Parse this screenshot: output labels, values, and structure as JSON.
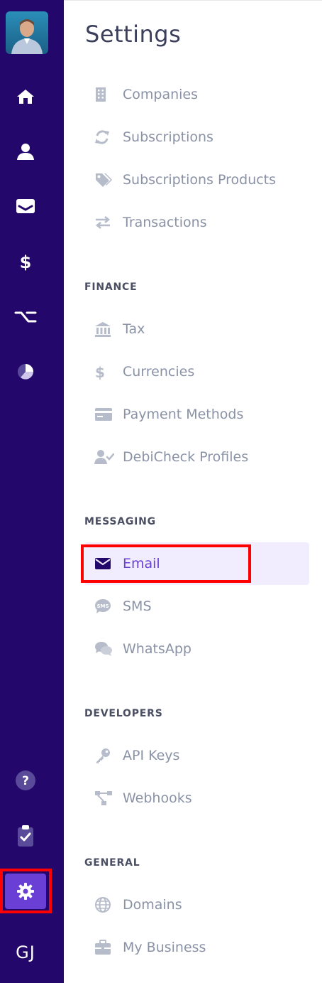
{
  "rail": {
    "items": [
      {
        "name": "home-icon"
      },
      {
        "name": "contacts-icon"
      },
      {
        "name": "inbox-icon"
      },
      {
        "name": "dollar-icon"
      },
      {
        "name": "workflow-icon"
      },
      {
        "name": "reports-pie-icon"
      },
      {
        "name": "help-icon"
      },
      {
        "name": "tasks-clipboard-icon"
      },
      {
        "name": "settings-gear-icon"
      }
    ],
    "initials": "GJ",
    "colors": {
      "background": "#24076a",
      "active": "#6a3fd6",
      "icon": "#ffffff"
    }
  },
  "settings": {
    "title": "Settings",
    "top_items": [
      "Companies",
      "Subscriptions",
      "Subscriptions Products",
      "Transactions"
    ],
    "finance": {
      "heading": "FINANCE",
      "items": [
        "Tax",
        "Currencies",
        "Payment Methods",
        "DebiCheck Profiles"
      ]
    },
    "messaging": {
      "heading": "MESSAGING",
      "items": [
        "Email",
        "SMS",
        "WhatsApp"
      ],
      "selected": "Email"
    },
    "developers": {
      "heading": "DEVELOPERS",
      "items": [
        "API Keys",
        "Webhooks"
      ]
    },
    "general": {
      "heading": "GENERAL",
      "items": [
        "Domains",
        "My Business"
      ]
    },
    "colors": {
      "item_text": "#8a92a6",
      "active_text": "#6a3fd6",
      "active_bg": "#f1ecfe",
      "heading": "#4b4f63"
    }
  }
}
